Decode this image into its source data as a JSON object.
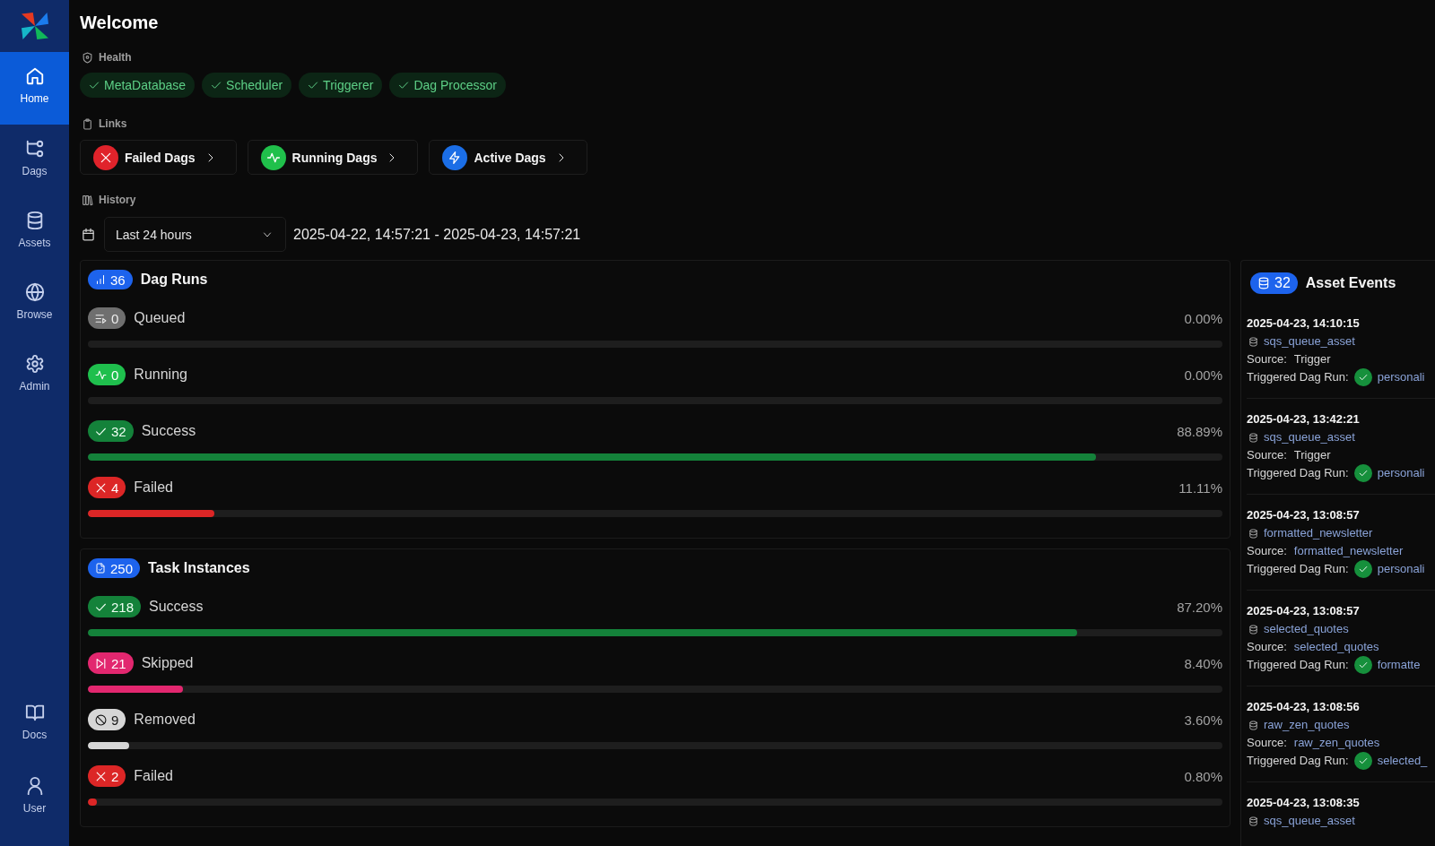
{
  "sidebar": {
    "items": [
      {
        "label": "Home",
        "selected": true
      },
      {
        "label": "Dags",
        "selected": false
      },
      {
        "label": "Assets",
        "selected": false
      },
      {
        "label": "Browse",
        "selected": false
      },
      {
        "label": "Admin",
        "selected": false
      }
    ],
    "bottom_items": [
      {
        "label": "Docs",
        "selected": false
      },
      {
        "label": "User",
        "selected": false
      }
    ]
  },
  "page": {
    "title": "Welcome"
  },
  "health": {
    "title": "Health",
    "items": [
      {
        "label": "MetaDatabase",
        "healthy": true
      },
      {
        "label": "Scheduler",
        "healthy": true
      },
      {
        "label": "Triggerer",
        "healthy": true
      },
      {
        "label": "Dag Processor",
        "healthy": true
      }
    ]
  },
  "links": {
    "title": "Links",
    "items": [
      {
        "label": "Failed Dags",
        "kind": "failed"
      },
      {
        "label": "Running Dags",
        "kind": "running"
      },
      {
        "label": "Active Dags",
        "kind": "active"
      }
    ]
  },
  "history": {
    "title": "History",
    "range_select": {
      "value": "Last 24 hours"
    },
    "date_range": "2025-04-22, 14:57:21 - 2025-04-23, 14:57:21"
  },
  "dag_runs": {
    "count": "36",
    "title": "Dag Runs",
    "states": [
      {
        "kind": "queued",
        "count": "0",
        "label": "Queued",
        "percent": "0.00%",
        "level": 0
      },
      {
        "kind": "running",
        "count": "0",
        "label": "Running",
        "percent": "0.00%",
        "level": 0
      },
      {
        "kind": "success",
        "count": "32",
        "label": "Success",
        "percent": "88.89%",
        "level": 0.8889
      },
      {
        "kind": "failed",
        "count": "4",
        "label": "Failed",
        "percent": "11.11%",
        "level": 0.1111
      }
    ]
  },
  "task_instances": {
    "count": "250",
    "title": "Task Instances",
    "states": [
      {
        "kind": "success",
        "count": "218",
        "label": "Success",
        "percent": "87.20%",
        "level": 0.872
      },
      {
        "kind": "skipped",
        "count": "21",
        "label": "Skipped",
        "percent": "8.40%",
        "level": 0.084
      },
      {
        "kind": "removed",
        "count": "9",
        "label": "Removed",
        "percent": "3.60%",
        "level": 0.036
      },
      {
        "kind": "failed",
        "count": "2",
        "label": "Failed",
        "percent": "0.80%",
        "level": 0.008
      }
    ]
  },
  "asset_events": {
    "count": "32",
    "title": "Asset Events",
    "events": [
      {
        "timestamp": "2025-04-23, 14:10:15",
        "asset": "sqs_queue_asset",
        "source_label": "Source:",
        "source": "Trigger",
        "source_link": false,
        "run_label": "Triggered Dag Run:",
        "run_succeeded": true,
        "run": "personali"
      },
      {
        "timestamp": "2025-04-23, 13:42:21",
        "asset": "sqs_queue_asset",
        "source_label": "Source:",
        "source": "Trigger",
        "source_link": false,
        "run_label": "Triggered Dag Run:",
        "run_succeeded": true,
        "run": "personali"
      },
      {
        "timestamp": "2025-04-23, 13:08:57",
        "asset": "formatted_newsletter",
        "source_label": "Source:",
        "source": "formatted_newsletter",
        "source_link": true,
        "run_label": "Triggered Dag Run:",
        "run_succeeded": true,
        "run": "personali"
      },
      {
        "timestamp": "2025-04-23, 13:08:57",
        "asset": "selected_quotes",
        "source_label": "Source:",
        "source": "selected_quotes",
        "source_link": true,
        "run_label": "Triggered Dag Run:",
        "run_succeeded": true,
        "run": "formatte"
      },
      {
        "timestamp": "2025-04-23, 13:08:56",
        "asset": "raw_zen_quotes",
        "source_label": "Source:",
        "source": "raw_zen_quotes",
        "source_link": true,
        "run_label": "Triggered Dag Run:",
        "run_succeeded": true,
        "run": "selected_"
      },
      {
        "timestamp": "2025-04-23, 13:08:35",
        "asset": "sqs_queue_asset"
      }
    ]
  }
}
